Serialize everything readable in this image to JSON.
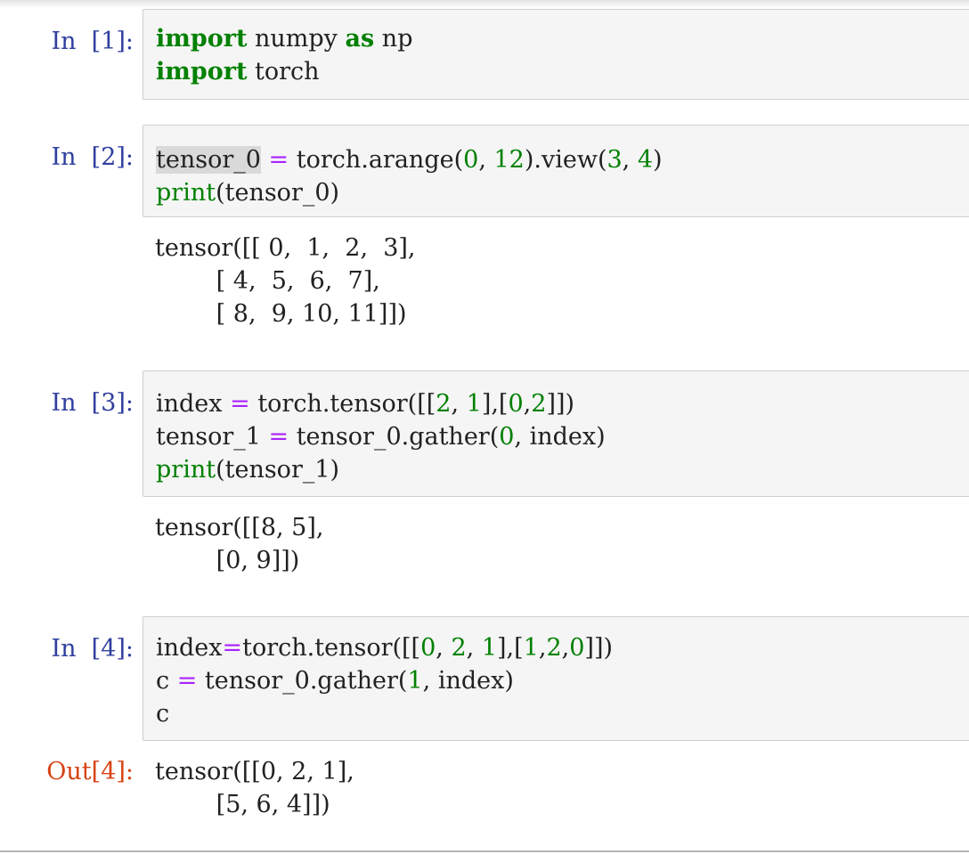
{
  "notebook": {
    "cells": [
      {
        "prompt": "In  [1]:",
        "lines": [
          [
            {
              "t": "import",
              "c": "kw"
            },
            {
              "t": " numpy ",
              "c": ""
            },
            {
              "t": "as",
              "c": "kw"
            },
            {
              "t": " np",
              "c": ""
            }
          ],
          [
            {
              "t": "import",
              "c": "kw"
            },
            {
              "t": " torch",
              "c": ""
            }
          ]
        ],
        "output_prompt": "",
        "output": []
      },
      {
        "prompt": "In  [2]:",
        "lines": [
          [
            {
              "t": "tensor_0",
              "c": "sel"
            },
            {
              "t": " ",
              "c": ""
            },
            {
              "t": "=",
              "c": "op"
            },
            {
              "t": " torch.arange(",
              "c": ""
            },
            {
              "t": "0",
              "c": "num"
            },
            {
              "t": ", ",
              "c": ""
            },
            {
              "t": "12",
              "c": "num"
            },
            {
              "t": ").view(",
              "c": ""
            },
            {
              "t": "3",
              "c": "num"
            },
            {
              "t": ", ",
              "c": ""
            },
            {
              "t": "4",
              "c": "num"
            },
            {
              "t": ")",
              "c": ""
            }
          ],
          [
            {
              "t": "print",
              "c": "bi"
            },
            {
              "t": "(tensor_0)",
              "c": ""
            }
          ]
        ],
        "output_prompt": "",
        "output": [
          "tensor([[ 0,  1,  2,  3],",
          "        [ 4,  5,  6,  7],",
          "        [ 8,  9, 10, 11]])"
        ]
      },
      {
        "prompt": "In  [3]:",
        "lines": [
          [
            {
              "t": "index ",
              "c": ""
            },
            {
              "t": "=",
              "c": "op"
            },
            {
              "t": " torch.tensor([[",
              "c": ""
            },
            {
              "t": "2",
              "c": "num"
            },
            {
              "t": ", ",
              "c": ""
            },
            {
              "t": "1",
              "c": "num"
            },
            {
              "t": "],[",
              "c": ""
            },
            {
              "t": "0",
              "c": "num"
            },
            {
              "t": ",",
              "c": ""
            },
            {
              "t": "2",
              "c": "num"
            },
            {
              "t": "]])",
              "c": ""
            }
          ],
          [
            {
              "t": "tensor_1 ",
              "c": ""
            },
            {
              "t": "=",
              "c": "op"
            },
            {
              "t": " tensor_0.gather(",
              "c": ""
            },
            {
              "t": "0",
              "c": "num"
            },
            {
              "t": ", index)",
              "c": ""
            }
          ],
          [
            {
              "t": "print",
              "c": "bi"
            },
            {
              "t": "(tensor_1)",
              "c": ""
            }
          ]
        ],
        "output_prompt": "",
        "output": [
          "tensor([[8, 5],",
          "        [0, 9]])"
        ]
      },
      {
        "prompt": "In  [4]:",
        "lines": [
          [
            {
              "t": "index",
              "c": ""
            },
            {
              "t": "=",
              "c": "op"
            },
            {
              "t": "torch.tensor([[",
              "c": ""
            },
            {
              "t": "0",
              "c": "num"
            },
            {
              "t": ", ",
              "c": ""
            },
            {
              "t": "2",
              "c": "num"
            },
            {
              "t": ", ",
              "c": ""
            },
            {
              "t": "1",
              "c": "num"
            },
            {
              "t": "],[",
              "c": ""
            },
            {
              "t": "1",
              "c": "num"
            },
            {
              "t": ",",
              "c": ""
            },
            {
              "t": "2",
              "c": "num"
            },
            {
              "t": ",",
              "c": ""
            },
            {
              "t": "0",
              "c": "num"
            },
            {
              "t": "]])",
              "c": ""
            }
          ],
          [
            {
              "t": "c ",
              "c": ""
            },
            {
              "t": "=",
              "c": "op"
            },
            {
              "t": " tensor_0.gather(",
              "c": ""
            },
            {
              "t": "1",
              "c": "num"
            },
            {
              "t": ", index)",
              "c": ""
            }
          ],
          [
            {
              "t": "c",
              "c": ""
            }
          ]
        ],
        "output_prompt": "Out[4]:",
        "output": [
          "tensor([[0, 2, 1],",
          "        [5, 6, 4]])"
        ]
      }
    ]
  },
  "colors": {
    "in_prompt": "#303f9f",
    "out_prompt": "#d84315",
    "keyword": "#008000",
    "number": "#008000",
    "operator": "#aa22ff",
    "cell_background": "#f5f5f5",
    "cell_border": "#cfcfcf"
  }
}
